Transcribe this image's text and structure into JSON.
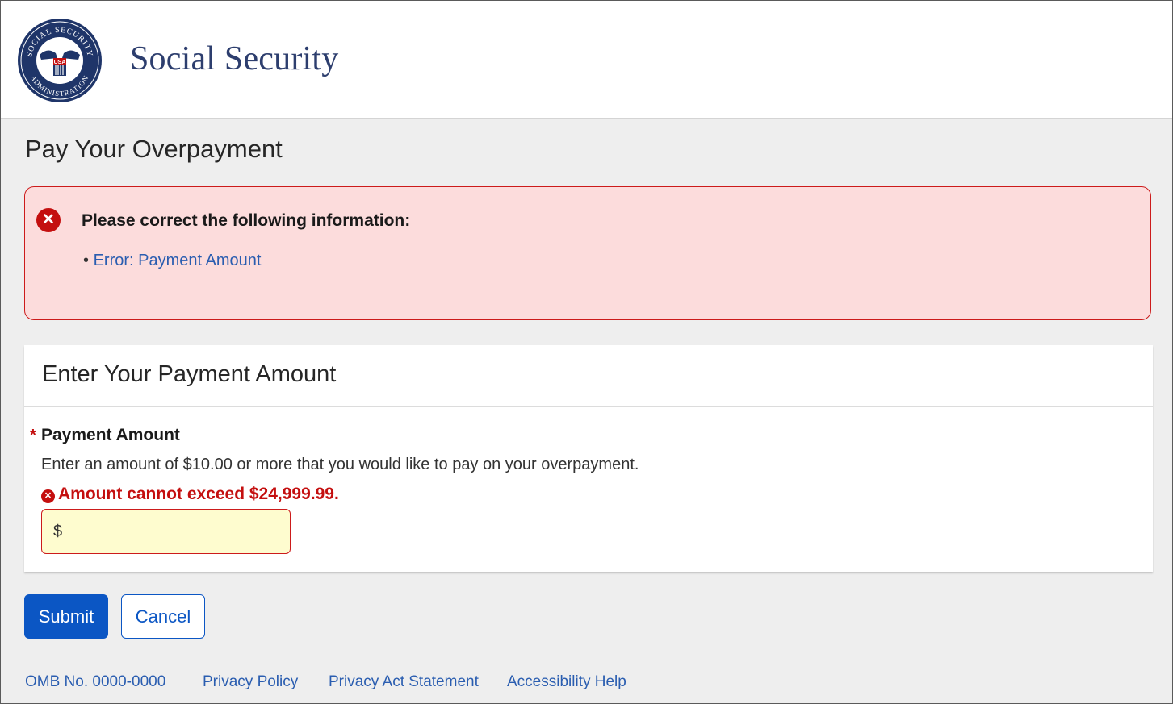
{
  "header": {
    "brand": "Social Security",
    "seal": {
      "top_text": "SOCIAL SECURITY",
      "bottom_text": "ADMINISTRATION",
      "center_text": "USA"
    }
  },
  "page_title": "Pay Your Overpayment",
  "error_summary": {
    "heading": "Please correct the following information:",
    "bullet": "•",
    "items": [
      "Error: Payment Amount"
    ]
  },
  "payment_card": {
    "title": "Enter Your Payment Amount",
    "required_marker": "*",
    "field_label": "Payment Amount",
    "help_text": "Enter an amount of $10.00 or more that you would like to pay on your overpayment.",
    "error_text": "Amount cannot exceed $24,999.99.",
    "currency_symbol": "$",
    "value": ""
  },
  "buttons": {
    "submit": "Submit",
    "cancel": "Cancel"
  },
  "footer": {
    "omb": "OMB No. 0000-0000",
    "links": [
      "Privacy Policy",
      "Privacy Act Statement",
      "Accessibility Help"
    ]
  },
  "colors": {
    "brand_text": "#2d3e6e",
    "error_red": "#c40f0f",
    "error_bg": "#fcdcdc",
    "primary_blue": "#0b56c4",
    "link_blue": "#2a5db0",
    "input_bg": "#fefccf"
  },
  "icons": {
    "seal": "ssa-seal-logo",
    "error_summary": "error-circle-x-icon",
    "field_error": "error-circle-x-icon"
  }
}
